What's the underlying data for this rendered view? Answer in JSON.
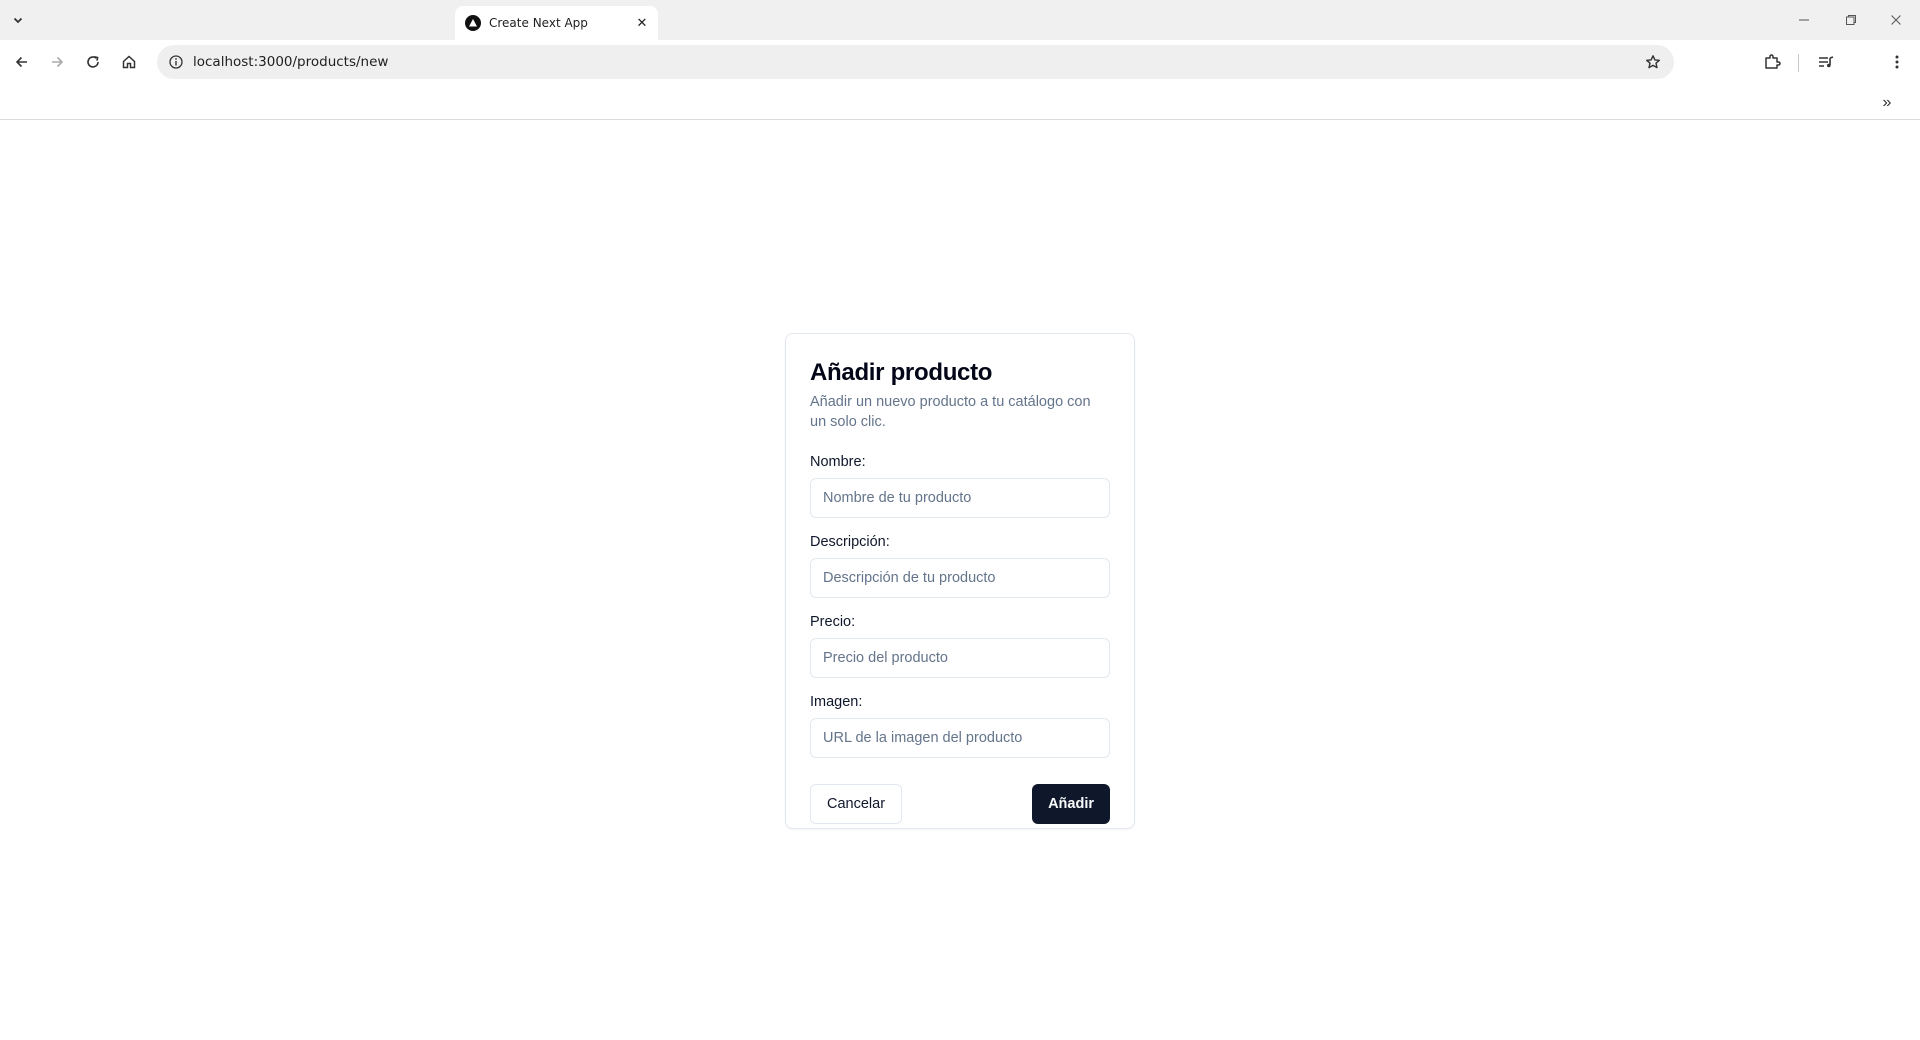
{
  "browser": {
    "tab_title": "Create Next App",
    "url": "localhost:3000/products/new",
    "icons": {
      "tab_list": "chevron-down-icon",
      "back": "back-arrow-icon",
      "forward": "forward-arrow-icon",
      "reload": "reload-icon",
      "home": "home-icon",
      "site_info": "info-icon",
      "bookmark": "star-icon",
      "extensions": "puzzle-icon",
      "media": "media-queue-icon",
      "menu": "kebab-menu-icon",
      "more_bookmarks": "double-chevron-icon"
    }
  },
  "form": {
    "title": "Añadir producto",
    "description": "Añadir un nuevo producto a tu catálogo con un solo clic.",
    "fields": [
      {
        "label": "Nombre:",
        "placeholder": "Nombre de tu producto",
        "value": ""
      },
      {
        "label": "Descripción:",
        "placeholder": "Descripción de tu producto",
        "value": ""
      },
      {
        "label": "Precio:",
        "placeholder": "Precio del producto",
        "value": ""
      },
      {
        "label": "Imagen:",
        "placeholder": "URL de la imagen del producto",
        "value": ""
      }
    ],
    "cancel_label": "Cancelar",
    "submit_label": "Añadir"
  },
  "colors": {
    "primary_button": "#0f172a",
    "muted_text": "#64748b",
    "border": "#e2e8f0"
  }
}
